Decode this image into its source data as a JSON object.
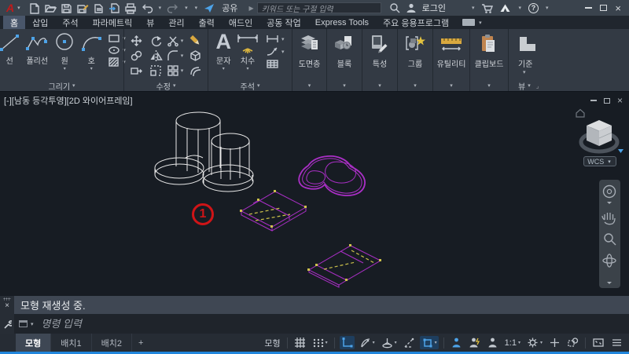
{
  "colors": {
    "c_white": "#e9e9e9",
    "c_magenta": "#aa2fc6",
    "c_yellow": "#cdc24b",
    "c_red": "#cf1417",
    "c_blue": "#4da3e8",
    "c_accent": "#2186dc"
  },
  "titlebar": {
    "share_label": "공유",
    "search_placeholder": "키워드 또는 구절 입력",
    "login_label": "로그인",
    "quick_access_icons": [
      "new-file",
      "open-file",
      "save",
      "save-as",
      "batch-plot",
      "export",
      "print",
      "undo",
      "redo",
      "qat-customize",
      "share"
    ]
  },
  "ribbon": {
    "tabs": [
      "홈",
      "삽입",
      "주석",
      "파라메트릭",
      "뷰",
      "관리",
      "출력",
      "애드인",
      "공동 작업",
      "Express Tools",
      "주요 응용프로그램"
    ],
    "draw": {
      "title": "그리기",
      "line": "선",
      "polyline": "폴리선",
      "circle": "원",
      "arc": "호"
    },
    "modify": {
      "title": "수정"
    },
    "annotate": {
      "title": "주석",
      "text": "문자",
      "dimension": "치수"
    },
    "layers": "도면층",
    "block": "블록",
    "properties": "특성",
    "group": "그룹",
    "utilities": "유틸리티",
    "clipboard": "클립보드",
    "base": "기준",
    "view_title": "뷰"
  },
  "viewport": {
    "label": "[-][남동 등각투영][2D 와이어프레임]",
    "wcs_label": "WCS",
    "marker_number": "1"
  },
  "commandline": {
    "history": "모형 재생성 중.",
    "prompt_placeholder": "명령 입력"
  },
  "statusbar": {
    "model_tab": "모형",
    "layout1_tab": "배치1",
    "layout2_tab": "배치2",
    "add_layout": "+",
    "model_space": "모형",
    "annotation_scale": "1:1",
    "icons": [
      "grid",
      "snap",
      "ortho",
      "polar-tracking",
      "isodraft",
      "osnap-tracking",
      "osnap",
      "annotation-visibility",
      "annotation-autoscale",
      "annotation-scale",
      "workspace-gear",
      "add",
      "isolate-objects",
      "clean-screen",
      "customize"
    ]
  }
}
